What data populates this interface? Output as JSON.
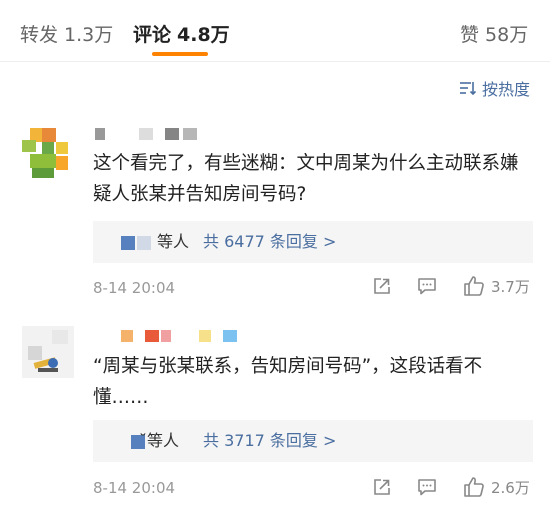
{
  "tabs": [
    {
      "label": "转发",
      "count": "1.3万"
    },
    {
      "label": "评论",
      "count": "4.8万"
    },
    {
      "label": "赞",
      "count": "58万"
    }
  ],
  "sort": {
    "label": "按热度",
    "icon": "sort-icon"
  },
  "comments": [
    {
      "text": "这个看完了，有些迷糊：文中周某为什么主动联系嫌疑人张某并告知房间号码?",
      "reply_prefix": "等人",
      "reply_link": "共 6477 条回复 >",
      "time": "8-14 20:04",
      "likes": "3.7万"
    },
    {
      "text": "“周某与张某联系，告知房间号码”，这段话看不懂……",
      "reply_prefix": "̆等人",
      "reply_link": "共 3717 条回复 >",
      "time": "8-14 20:04",
      "likes": "2.6万"
    }
  ],
  "icons": [
    "share-icon",
    "comment-icon",
    "like-icon"
  ],
  "colors": {
    "accent": "#ff8200",
    "link": "#4a6ea0",
    "text": "#222222",
    "meta": "#999999",
    "reply_bg": "#f5f5f5"
  }
}
